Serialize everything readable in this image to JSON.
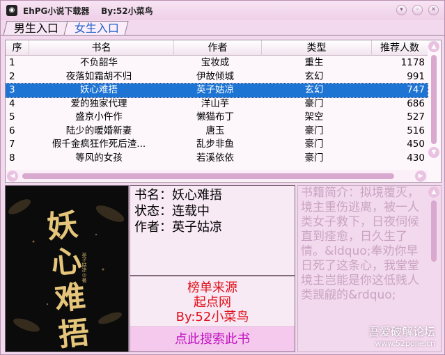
{
  "window": {
    "title": "EhPG小说下载器    By:52小菜鸟",
    "icon": "app-icon"
  },
  "tabs": [
    {
      "label": "男生入口",
      "active": false
    },
    {
      "label": "女生入口",
      "active": true
    }
  ],
  "table": {
    "headers": [
      "序",
      "书名",
      "作者",
      "类型",
      "推荐人数"
    ],
    "rows": [
      [
        "1",
        "不负韶华",
        "宝妆成",
        "重生",
        "1178"
      ],
      [
        "2",
        "夜落如霜胡不归",
        "伊故倾城",
        "玄幻",
        "991"
      ],
      [
        "3",
        "妖心难捂",
        "英子姑凉",
        "玄幻",
        "747"
      ],
      [
        "4",
        "爱的独家代理",
        "洋山芋",
        "豪门",
        "686"
      ],
      [
        "5",
        "盛京小仵作",
        "懒猫布丁",
        "架空",
        "527"
      ],
      [
        "6",
        "陆少的暖婚新妻",
        "唐玉",
        "豪门",
        "516"
      ],
      [
        "7",
        "假千金疯狂作死后渣...",
        "乱步非鱼",
        "豪门",
        "450"
      ],
      [
        "8",
        "等风的女孩",
        "若溪依依",
        "豪门",
        "430"
      ]
    ],
    "selected_index": 2
  },
  "cover": {
    "title": "妖心难捂",
    "author": "英子姑凉◎著"
  },
  "info": {
    "name_line": "书名：妖心难捂",
    "status_line": "状态：连载中",
    "author_line": "作者：英子姑凉"
  },
  "source": {
    "heading": "榜单来源",
    "site": "起点网",
    "by": "By:52小菜鸟",
    "search_button": "点此搜索此书"
  },
  "intro": {
    "text": "书籍简介：拟境覆灭，境主重伤逃离，被一人类女子救下，日夜伺候直到痊愈，日久生了情。&ldquo;奉劝你早日死了这条心，我堂堂境主岂能是你这低贱人类觊觎的&rdquo;"
  },
  "watermark": {
    "line1": "吾爱破解论坛",
    "line2": "www.52pojie.cn"
  },
  "colors": {
    "window_bg": "#f3d9ee",
    "selection": "#1e74d3",
    "source_text": "#e0101a",
    "search_text": "#c010c0",
    "active_tab_text": "#1e60c8"
  }
}
